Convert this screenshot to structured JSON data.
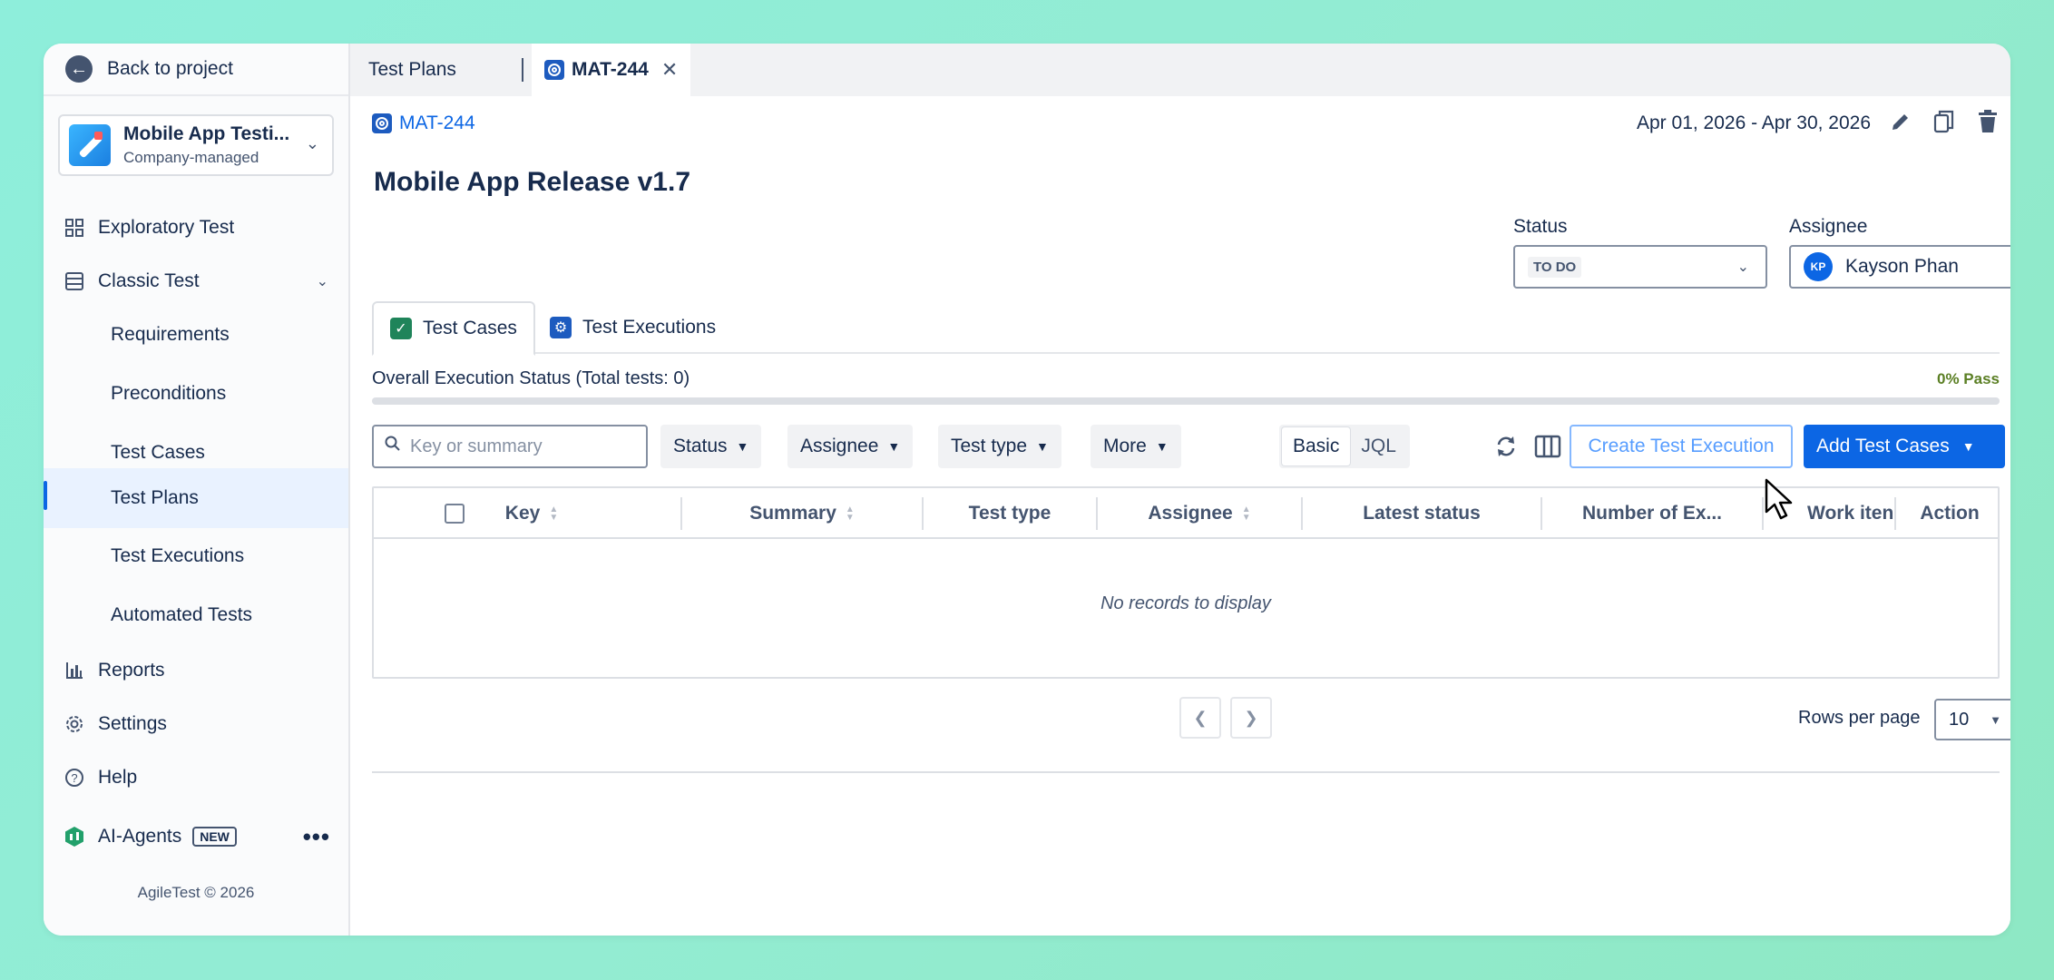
{
  "back": {
    "label": "Back to project"
  },
  "project": {
    "name": "Mobile App Testi...",
    "type": "Company-managed"
  },
  "sidebar": {
    "items": [
      {
        "label": "Exploratory Test"
      },
      {
        "label": "Classic Test"
      },
      {
        "label": "Requirements"
      },
      {
        "label": "Preconditions"
      },
      {
        "label": "Test Cases"
      },
      {
        "label": "Test Plans"
      },
      {
        "label": "Test Executions"
      },
      {
        "label": "Automated Tests"
      },
      {
        "label": "Reports"
      },
      {
        "label": "Settings"
      },
      {
        "label": "Help"
      },
      {
        "label": "AI-Agents"
      }
    ],
    "new_badge": "NEW",
    "footer": "AgileTest © 2026"
  },
  "tabs": [
    {
      "label": "Test Plans"
    },
    {
      "label": "MAT-244"
    }
  ],
  "header": {
    "breadcrumb": "MAT-244",
    "date_range": "Apr 01, 2026 - Apr 30, 2026",
    "title": "Mobile App Release v1.7",
    "status_label": "Status",
    "status_value": "TO DO",
    "assignee_label": "Assignee",
    "assignee_initials": "KP",
    "assignee_name": "Kayson Phan"
  },
  "sub_tabs": [
    {
      "label": "Test Cases"
    },
    {
      "label": "Test Executions"
    }
  ],
  "execution": {
    "status_text": "Overall Execution Status (Total tests: 0)",
    "pass_text": "0% Pass",
    "pass_fraction": 0
  },
  "toolbar": {
    "search_placeholder": "Key or summary",
    "filters": [
      "Status",
      "Assignee",
      "Test type",
      "More"
    ],
    "mode_basic": "Basic",
    "mode_jql": "JQL",
    "create_execution": "Create Test Execution",
    "add_cases": "Add Test Cases"
  },
  "table": {
    "columns": [
      "Key",
      "Summary",
      "Test type",
      "Assignee",
      "Latest status",
      "Number of Ex...",
      "Work iten",
      "Action"
    ],
    "empty_text": "No records to display"
  },
  "pagination": {
    "rows_per_page_label": "Rows per page",
    "rows_per_page_value": "10"
  },
  "colors": {
    "accent": "#0c66e4",
    "active_nav_bg": "#e9f2ff",
    "pass_text": "#5b7f24"
  }
}
